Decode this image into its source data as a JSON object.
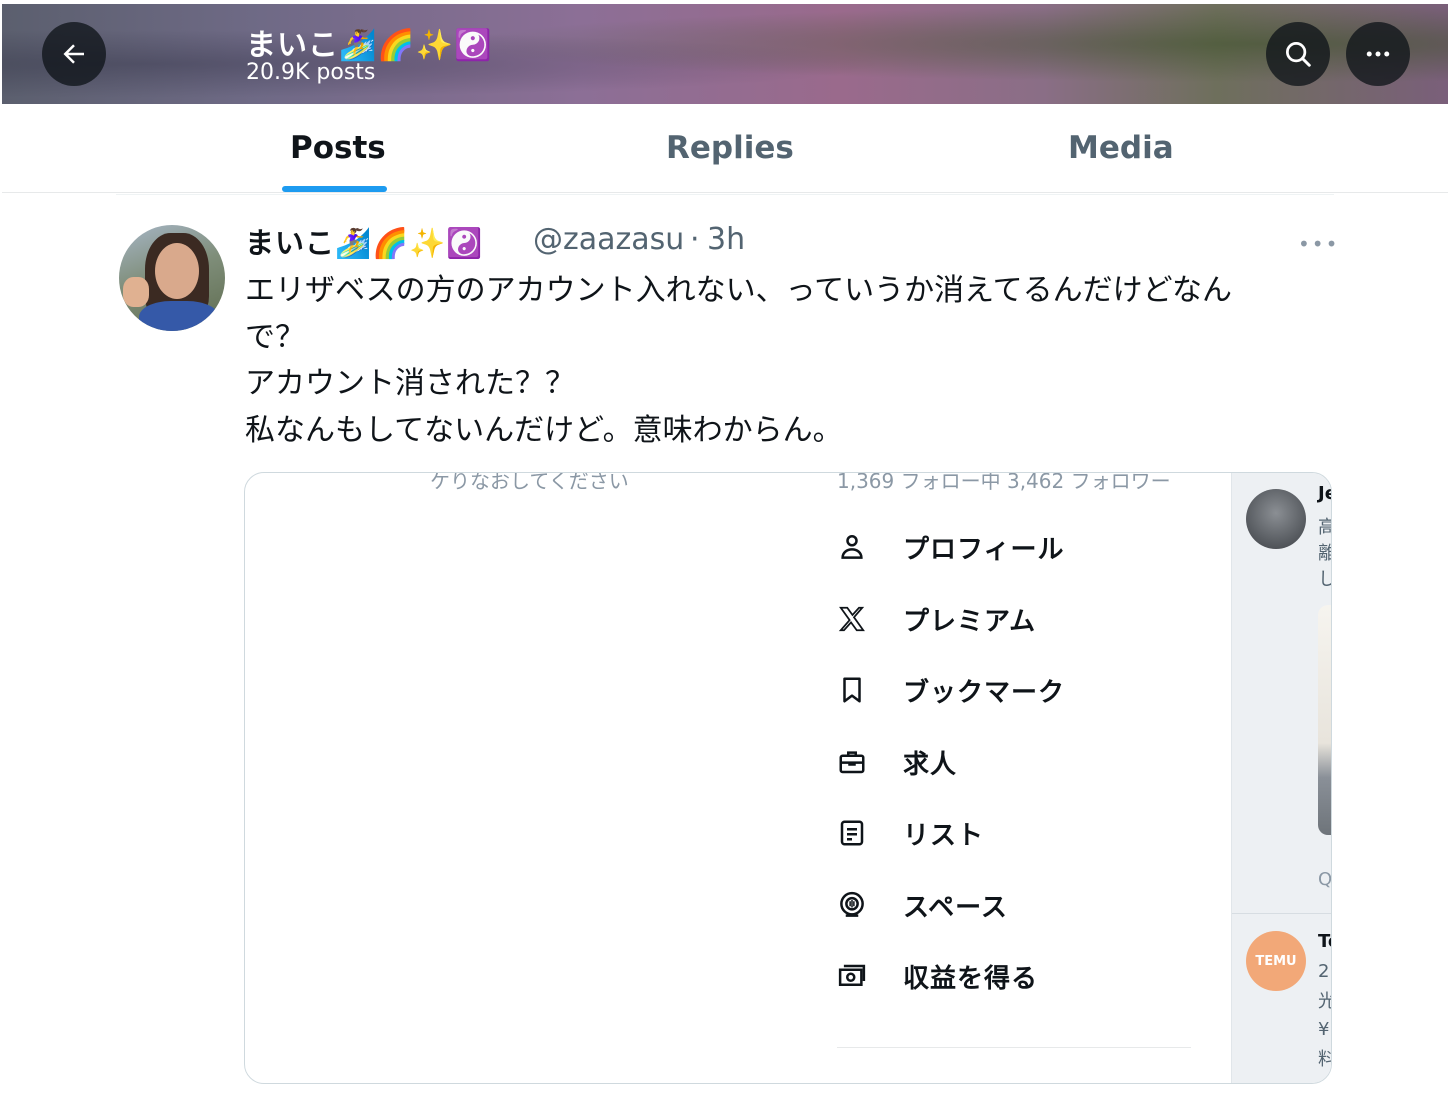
{
  "header": {
    "name": "まいこ🏄‍♀️🌈✨☯️",
    "post_count": "20.9K posts"
  },
  "tabs": [
    {
      "label": "Posts",
      "active": true
    },
    {
      "label": "Replies",
      "active": false
    },
    {
      "label": "Media",
      "active": false
    }
  ],
  "post": {
    "author": "まいこ🏄‍♀️🌈✨☯️",
    "handle": "@zaazasu",
    "separator": "·",
    "time": "3h",
    "more": "•••",
    "lines": [
      "エリザベスの方のアカウント入れない、っていうか消えてるんだけどなん",
      "で？",
      "アカウント消された？？",
      "私なんもしてないんだけど。意味わからん。"
    ],
    "media": {
      "top_cut_left": "ケりなおしてください",
      "top_cut_right": "1,369 フォロー中 3,462 フォロワー",
      "menu": [
        {
          "label": "プロフィール",
          "icon": "profile-icon"
        },
        {
          "label": "プレミアム",
          "icon": "x-logo-icon"
        },
        {
          "label": "ブックマーク",
          "icon": "bookmark-icon"
        },
        {
          "label": "求人",
          "icon": "briefcase-icon"
        },
        {
          "label": "リスト",
          "icon": "list-icon"
        },
        {
          "label": "スペース",
          "icon": "spaces-icon"
        },
        {
          "label": "収益を得る",
          "icon": "money-icon"
        }
      ],
      "right_panel": {
        "name1": "Je",
        "lines1": [
          "高",
          "離",
          "し"
        ],
        "reply_glyph": "Q",
        "name2": "Te",
        "lines2": [
          "2",
          "光",
          "¥",
          "料"
        ],
        "temu_logo": "TEMU"
      }
    }
  },
  "colors": {
    "accent": "#1d9bf0",
    "text_primary": "#0f1419",
    "text_secondary": "#536471"
  }
}
